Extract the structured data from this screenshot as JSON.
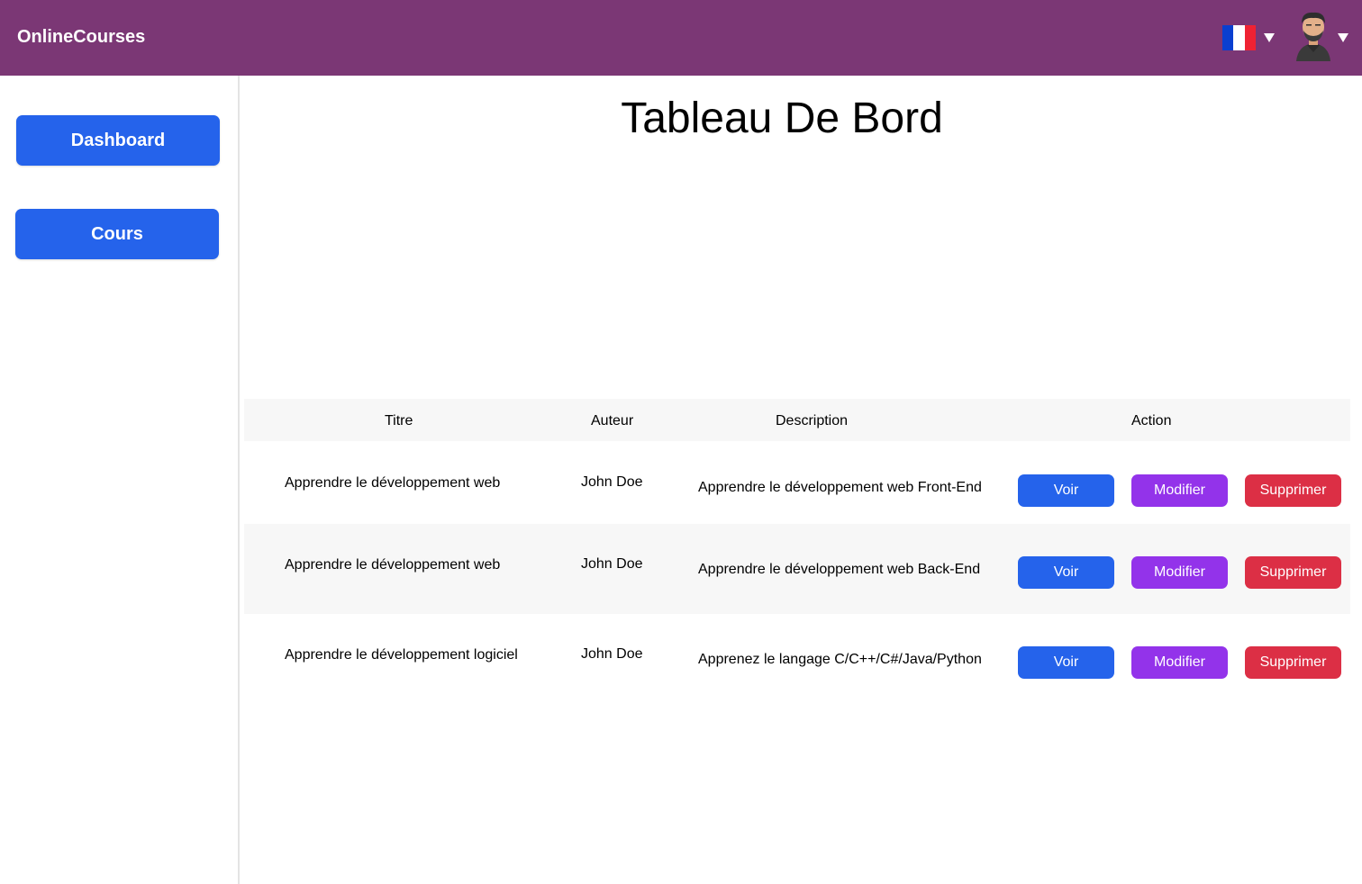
{
  "header": {
    "brand": "OnlineCourses",
    "language_flag": "fr-flag-icon",
    "colors": {
      "bar": "#7b3775",
      "flag_blue": "#0a3fd0",
      "flag_white": "#ffffff",
      "flag_red": "#ef2233"
    }
  },
  "sidebar": {
    "items": [
      {
        "label": "Dashboard"
      },
      {
        "label": "Cours"
      }
    ],
    "button_color": "#2563eb"
  },
  "main": {
    "title": "Tableau De Bord",
    "table": {
      "headers": [
        "Titre",
        "Auteur",
        "Description",
        "Action"
      ],
      "rows": [
        {
          "title": "Apprendre le développement web",
          "author": "John Doe",
          "description": "Apprendre le développement web Front-End"
        },
        {
          "title": "Apprendre le développement web",
          "author": "John Doe",
          "description": "Apprendre le développement web Back-End"
        },
        {
          "title": "Apprendre le développement logiciel",
          "author": "John Doe",
          "description": "Apprenez le langage C/C++/C#/Java/Python"
        }
      ],
      "actions": {
        "view": "Voir",
        "edit": "Modifier",
        "delete": "Supprimer"
      },
      "action_colors": {
        "view": "#2563eb",
        "edit": "#9333ea",
        "delete": "#dc2f45"
      }
    }
  }
}
